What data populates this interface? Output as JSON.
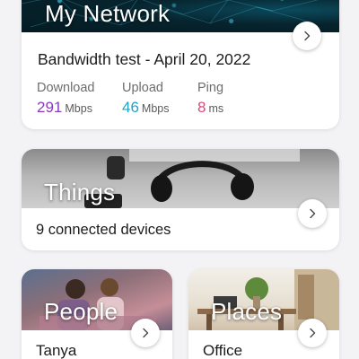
{
  "network": {
    "title": "My Network",
    "test_title": "Bandwidth test - April 20, 2022",
    "metrics": [
      {
        "label": "Download",
        "value": "291",
        "unit": "Mbps",
        "color": "#8a3bbf"
      },
      {
        "label": "Upload",
        "value": "46",
        "unit": "Mbps",
        "color": "#1fa3c6"
      },
      {
        "label": "Ping",
        "value": "8",
        "unit": "ms",
        "color": "#e0457b"
      }
    ]
  },
  "things": {
    "title": "Things",
    "subtitle": "9 connected devices"
  },
  "people": {
    "title": "People",
    "subtitle": "Tanya"
  },
  "places": {
    "title": "Places",
    "subtitle": "Office"
  },
  "icons": {
    "chevron": "chevron-right-icon"
  }
}
